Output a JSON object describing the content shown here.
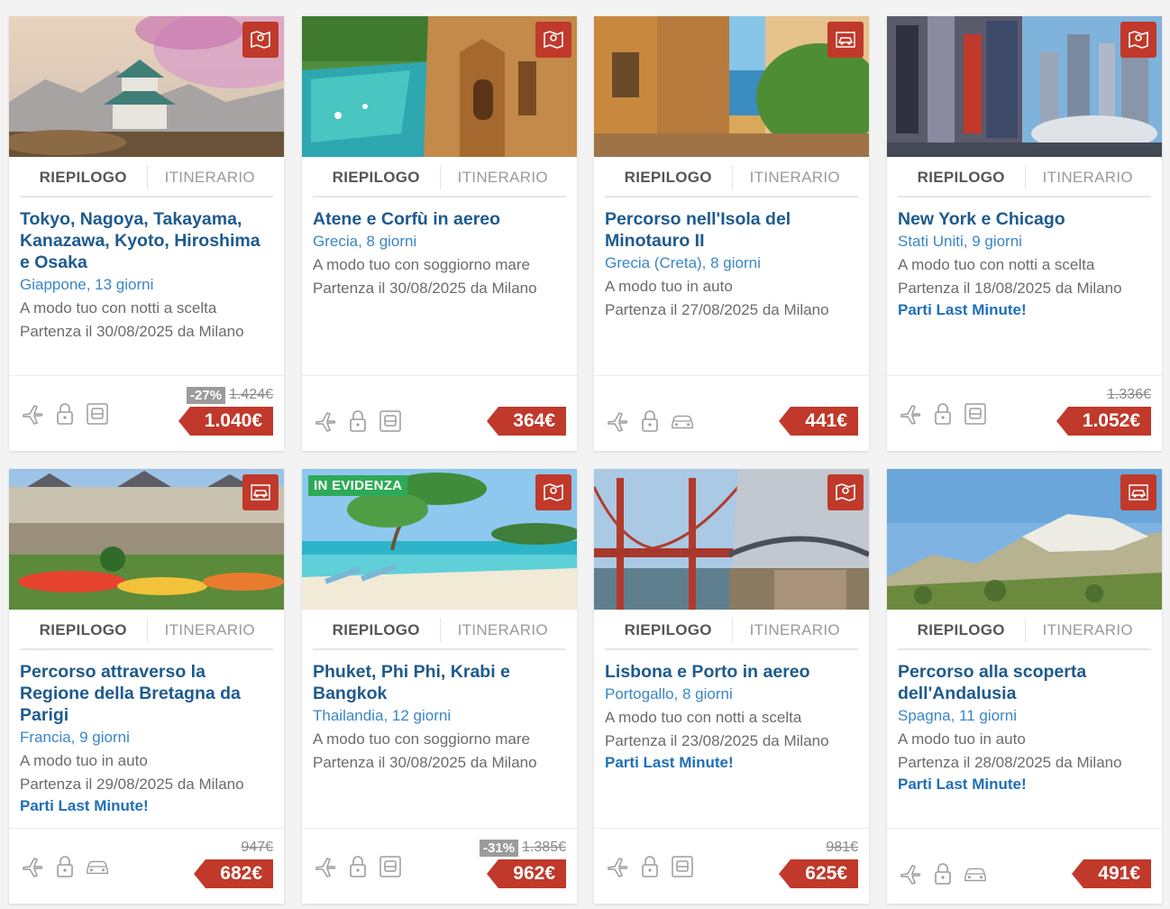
{
  "tabs": {
    "summary": "RIEPILOGO",
    "itinerary": "ITINERARIO"
  },
  "cards": [
    {
      "title": "Tokyo, Nagoya, Takayama, Kanazawa, Kyoto, Hiroshima e Osaka",
      "subtitle": "Giappone, 13 giorni",
      "mode": "A modo tuo con notti a scelta",
      "departure": "Partenza il 30/08/2025 da Milano",
      "last_minute": "",
      "discount": "-27%",
      "old_price": "1.424€",
      "price": "1.040€",
      "badge_icon": "map-route-icon",
      "transport_icon": "transfer-icon",
      "evidence": ""
    },
    {
      "title": "Atene e Corfù in aereo",
      "subtitle": "Grecia, 8 giorni",
      "mode": "A modo tuo con soggiorno mare",
      "departure": "Partenza il 30/08/2025 da Milano",
      "last_minute": "",
      "discount": "",
      "old_price": "",
      "price": "364€",
      "badge_icon": "map-route-icon",
      "transport_icon": "transfer-icon",
      "evidence": ""
    },
    {
      "title": "Percorso nell'Isola del Minotauro II",
      "subtitle": "Grecia (Creta), 8 giorni",
      "mode": "A modo tuo in auto",
      "departure": "Partenza il 27/08/2025 da Milano",
      "last_minute": "",
      "discount": "",
      "old_price": "",
      "price": "441€",
      "badge_icon": "car-map-icon",
      "transport_icon": "car-icon",
      "evidence": ""
    },
    {
      "title": "New York e Chicago",
      "subtitle": "Stati Uniti, 9 giorni",
      "mode": "A modo tuo con notti a scelta",
      "departure": "Partenza il 18/08/2025 da Milano",
      "last_minute": "Parti Last Minute!",
      "discount": "",
      "old_price": "1.336€",
      "price": "1.052€",
      "badge_icon": "map-route-icon",
      "transport_icon": "transfer-icon",
      "evidence": ""
    },
    {
      "title": "Percorso attraverso la Regione della Bretagna da Parigi",
      "subtitle": "Francia, 9 giorni",
      "mode": "A modo tuo in auto",
      "departure": "Partenza il 29/08/2025 da Milano",
      "last_minute": "Parti Last Minute!",
      "discount": "",
      "old_price": "947€",
      "price": "682€",
      "badge_icon": "car-map-icon",
      "transport_icon": "car-icon",
      "evidence": ""
    },
    {
      "title": "Phuket, Phi Phi, Krabi e Bangkok",
      "subtitle": "Thailandia, 12 giorni",
      "mode": "A modo tuo con soggiorno mare",
      "departure": "Partenza il 30/08/2025 da Milano",
      "last_minute": "",
      "discount": "-31%",
      "old_price": "1.385€",
      "price": "962€",
      "badge_icon": "map-route-icon",
      "transport_icon": "transfer-icon",
      "evidence": "IN EVIDENZA"
    },
    {
      "title": "Lisbona e Porto in aereo",
      "subtitle": "Portogallo, 8 giorni",
      "mode": "A modo tuo con notti a scelta",
      "departure": "Partenza il 23/08/2025 da Milano",
      "last_minute": "Parti Last Minute!",
      "discount": "",
      "old_price": "981€",
      "price": "625€",
      "badge_icon": "map-route-icon",
      "transport_icon": "transfer-icon",
      "evidence": ""
    },
    {
      "title": "Percorso alla scoperta dell'Andalusia",
      "subtitle": "Spagna, 11 giorni",
      "mode": "A modo tuo in auto",
      "departure": "Partenza il 28/08/2025 da Milano",
      "last_minute": "Parti Last Minute!",
      "discount": "",
      "old_price": "",
      "price": "491€",
      "badge_icon": "car-map-icon",
      "transport_icon": "car-icon",
      "evidence": ""
    }
  ],
  "colors": {
    "title": "#1e5a8e",
    "subtitle": "#3a86c6",
    "price_bg": "#c0392b",
    "evidence_bg": "#2eaa57"
  }
}
